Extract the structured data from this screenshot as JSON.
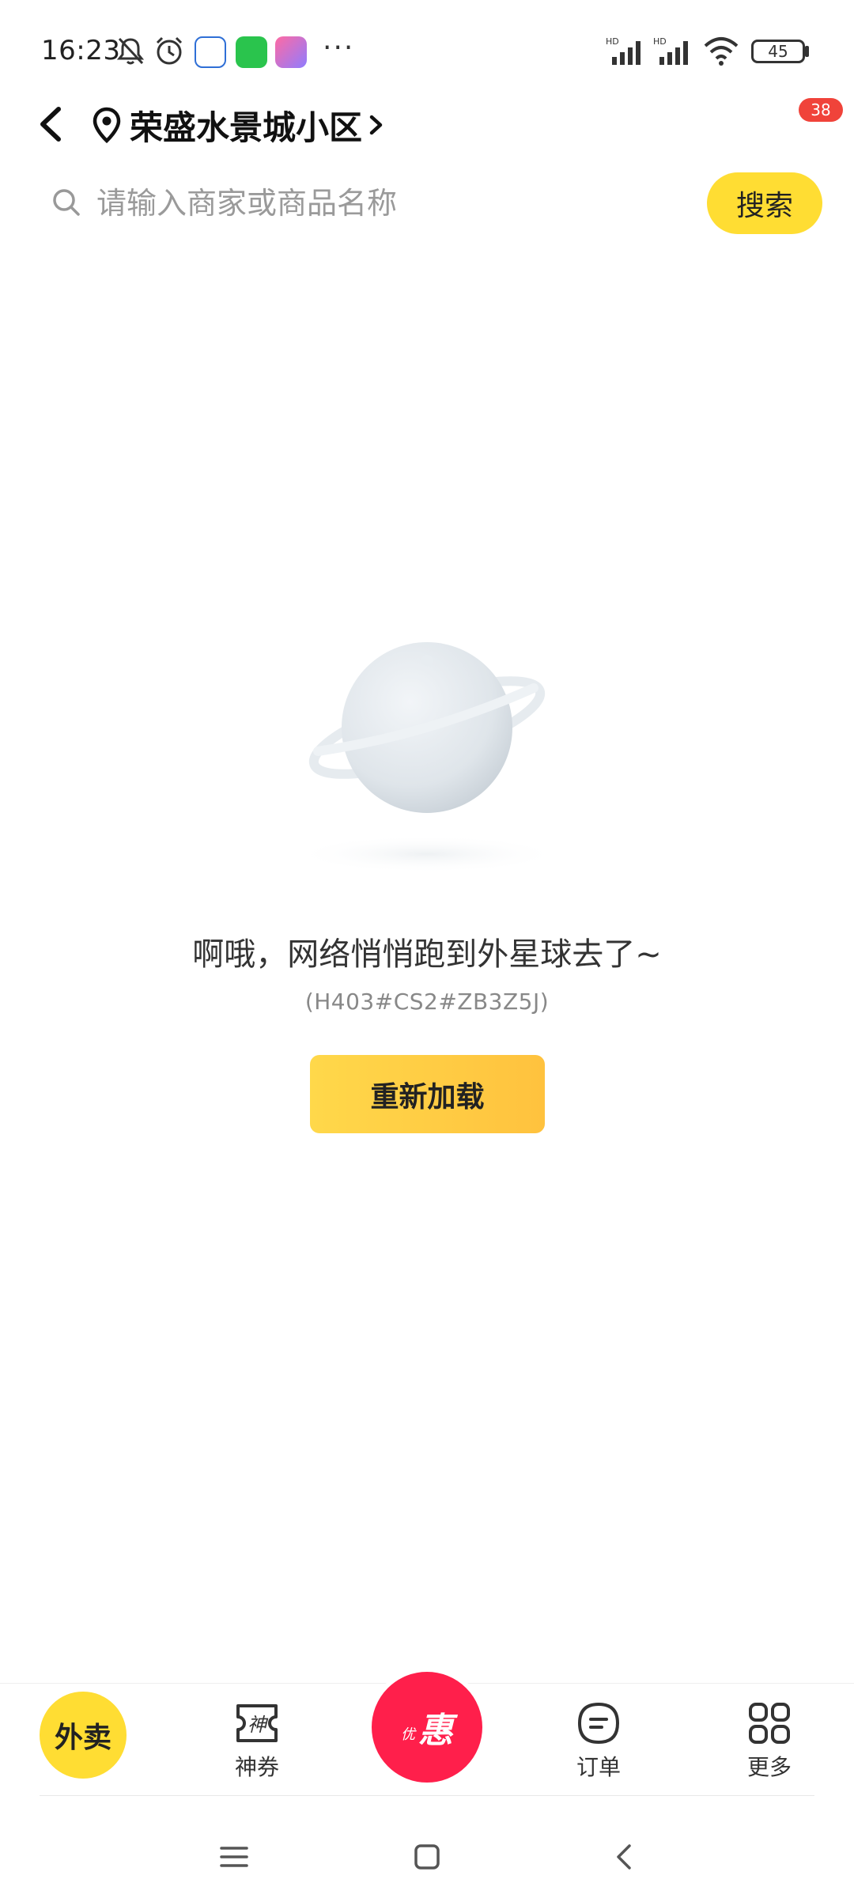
{
  "status_bar": {
    "time": "16:23",
    "more": "···",
    "battery": "45",
    "icons": [
      "mute-bell-icon",
      "alarm-icon",
      "app-icon",
      "wechat-icon",
      "game-icon",
      "signal-hd-icon",
      "signal-hd-icon",
      "wifi-icon",
      "battery-icon"
    ]
  },
  "header": {
    "location": "荣盛水景城小区",
    "badge_count": "38"
  },
  "search": {
    "placeholder": "请输入商家或商品名称",
    "button_label": "搜索"
  },
  "error": {
    "message": "啊哦，网络悄悄跑到外星球去了~",
    "code": "(H403#CS2#ZB3Z5J)",
    "reload_label": "重新加载"
  },
  "tabs": [
    {
      "label": "外卖",
      "icon": "waimai-logo"
    },
    {
      "label": "神券",
      "icon": "coupon-icon"
    },
    {
      "label": "优惠",
      "icon": "promo-icon",
      "small": "优",
      "big": "惠"
    },
    {
      "label": "订单",
      "icon": "order-icon"
    },
    {
      "label": "更多",
      "icon": "grid-icon"
    }
  ],
  "colors": {
    "accent_yellow": "#ffdd33",
    "promo_red": "#ff1f4b",
    "badge_red": "#f0433a"
  }
}
